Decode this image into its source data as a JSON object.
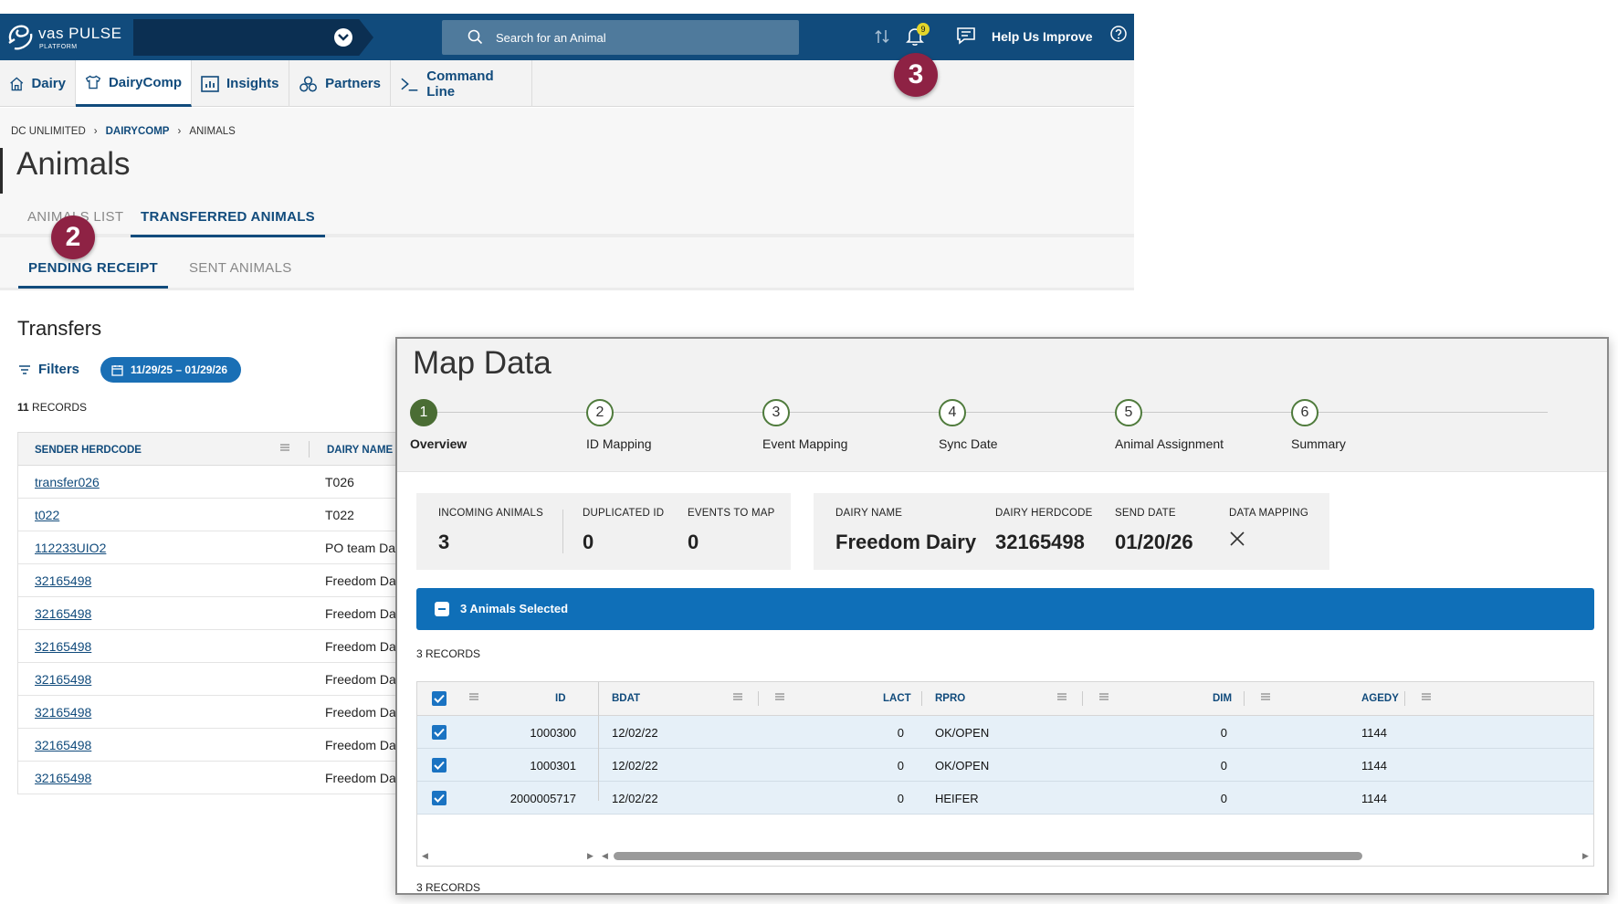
{
  "app": {
    "logo_name": "vas PULSE",
    "logo_sub": "PLATFORM",
    "search_placeholder": "Search for an Animal",
    "bell_count": "9",
    "help_label": "Help Us Improve",
    "nav": [
      "Dairy",
      "DairyComp",
      "Insights",
      "Partners",
      "Command Line"
    ],
    "breadcrumb": [
      "DC UNLIMITED",
      "DAIRYCOMP",
      "ANIMALS"
    ],
    "page_title": "Animals",
    "tabs": [
      "ANIMALS LIST",
      "TRANSFERRED ANIMALS"
    ],
    "subtabs": [
      "PENDING RECEIPT",
      "SENT ANIMALS"
    ],
    "section_title": "Transfers",
    "filters_label": "Filters",
    "date_range": "11/29/25 – 01/29/26",
    "records_count": "11",
    "records_label": "RECORDS",
    "table_headers": [
      "SENDER HERDCODE",
      "DAIRY NAME"
    ],
    "rows": [
      {
        "herdcode": "transfer026",
        "dairy": "T026"
      },
      {
        "herdcode": "t022",
        "dairy": "T022"
      },
      {
        "herdcode": "112233UIO2",
        "dairy": "PO team Da"
      },
      {
        "herdcode": "32165498",
        "dairy": "Freedom Da"
      },
      {
        "herdcode": "32165498",
        "dairy": "Freedom Da"
      },
      {
        "herdcode": "32165498",
        "dairy": "Freedom Da"
      },
      {
        "herdcode": "32165498",
        "dairy": "Freedom Da"
      },
      {
        "herdcode": "32165498",
        "dairy": "Freedom Da"
      },
      {
        "herdcode": "32165498",
        "dairy": "Freedom Da"
      },
      {
        "herdcode": "32165498",
        "dairy": "Freedom Da"
      }
    ]
  },
  "callouts": [
    "2",
    "3"
  ],
  "mapdata": {
    "title": "Map Data",
    "steps": [
      {
        "num": "1",
        "label": "Overview"
      },
      {
        "num": "2",
        "label": "ID Mapping"
      },
      {
        "num": "3",
        "label": "Event Mapping"
      },
      {
        "num": "4",
        "label": "Sync Date"
      },
      {
        "num": "5",
        "label": "Animal Assignment"
      },
      {
        "num": "6",
        "label": "Summary"
      }
    ],
    "stats": {
      "incoming_label": "INCOMING ANIMALS",
      "incoming": "3",
      "duplicated_label": "DUPLICATED ID",
      "duplicated": "0",
      "events_label": "EVENTS TO MAP",
      "events": "0",
      "dairy_label": "DAIRY NAME",
      "dairy": "Freedom Dairy",
      "herdcode_label": "DAIRY HERDCODE",
      "herdcode": "32165498",
      "send_label": "SEND DATE",
      "send": "01/20/26",
      "mapping_label": "DATA MAPPING",
      "mapping_icon": "close-icon"
    },
    "selected_label": "3 Animals Selected",
    "records_label": "3 RECORDS",
    "grid_headers": [
      "ID",
      "BDAT",
      "LACT",
      "RPRO",
      "DIM",
      "AGEDY"
    ],
    "grid_rows": [
      {
        "id": "1000300",
        "bdat": "12/02/22",
        "lact": "0",
        "rpro": "OK/OPEN",
        "dim": "0",
        "agedy": "1144"
      },
      {
        "id": "1000301",
        "bdat": "12/02/22",
        "lact": "0",
        "rpro": "OK/OPEN",
        "dim": "0",
        "agedy": "1144"
      },
      {
        "id": "2000005717",
        "bdat": "12/02/22",
        "lact": "0",
        "rpro": "HEIFER",
        "dim": "0",
        "agedy": "1144"
      }
    ],
    "footer_records": "3 RECORDS"
  }
}
